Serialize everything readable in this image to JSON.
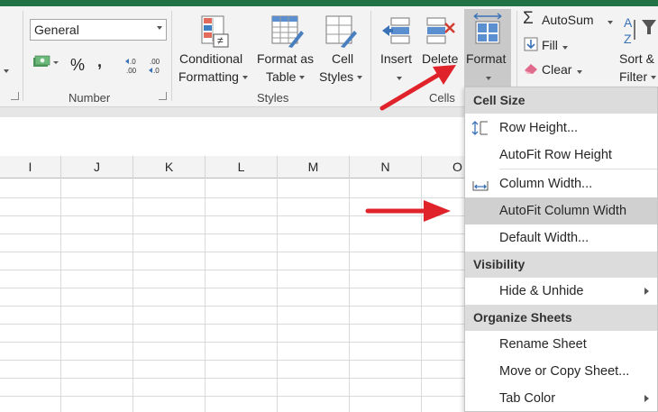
{
  "number_group": {
    "format_value": "General",
    "percent": "%",
    "comma": ",",
    "inc_decimal": "←.0\n.00",
    "dec_decimal": ".00\n→.0",
    "label": "Number"
  },
  "styles_group": {
    "conditional_line1": "Conditional",
    "conditional_line2": "Formatting",
    "format_table_line1": "Format as",
    "format_table_line2": "Table",
    "cell_styles_line1": "Cell",
    "cell_styles_line2": "Styles",
    "label": "Styles"
  },
  "cells_group": {
    "insert": "Insert",
    "delete": "Delete",
    "format": "Format",
    "label": "Cells"
  },
  "editing_group": {
    "autosum": "AutoSum",
    "fill": "Fill",
    "clear": "Clear",
    "sort_line1": "Sort &",
    "sort_line2": "Filter"
  },
  "columns": [
    "I",
    "J",
    "K",
    "L",
    "M",
    "N",
    "O"
  ],
  "format_menu": {
    "cell_size_header": "Cell Size",
    "row_height": "Row Height...",
    "autofit_row_height": "AutoFit Row Height",
    "column_width": "Column Width...",
    "autofit_column_width": "AutoFit Column Width",
    "default_width": "Default Width...",
    "visibility_header": "Visibility",
    "hide_unhide": "Hide & Unhide",
    "organize_header": "Organize Sheets",
    "rename_sheet": "Rename Sheet",
    "move_copy_sheet": "Move or Copy Sheet...",
    "tab_color": "Tab Color"
  },
  "colors": {
    "excel_green": "#217346",
    "arrow_red": "#e0232a",
    "highlight": "#d0d0d0"
  }
}
